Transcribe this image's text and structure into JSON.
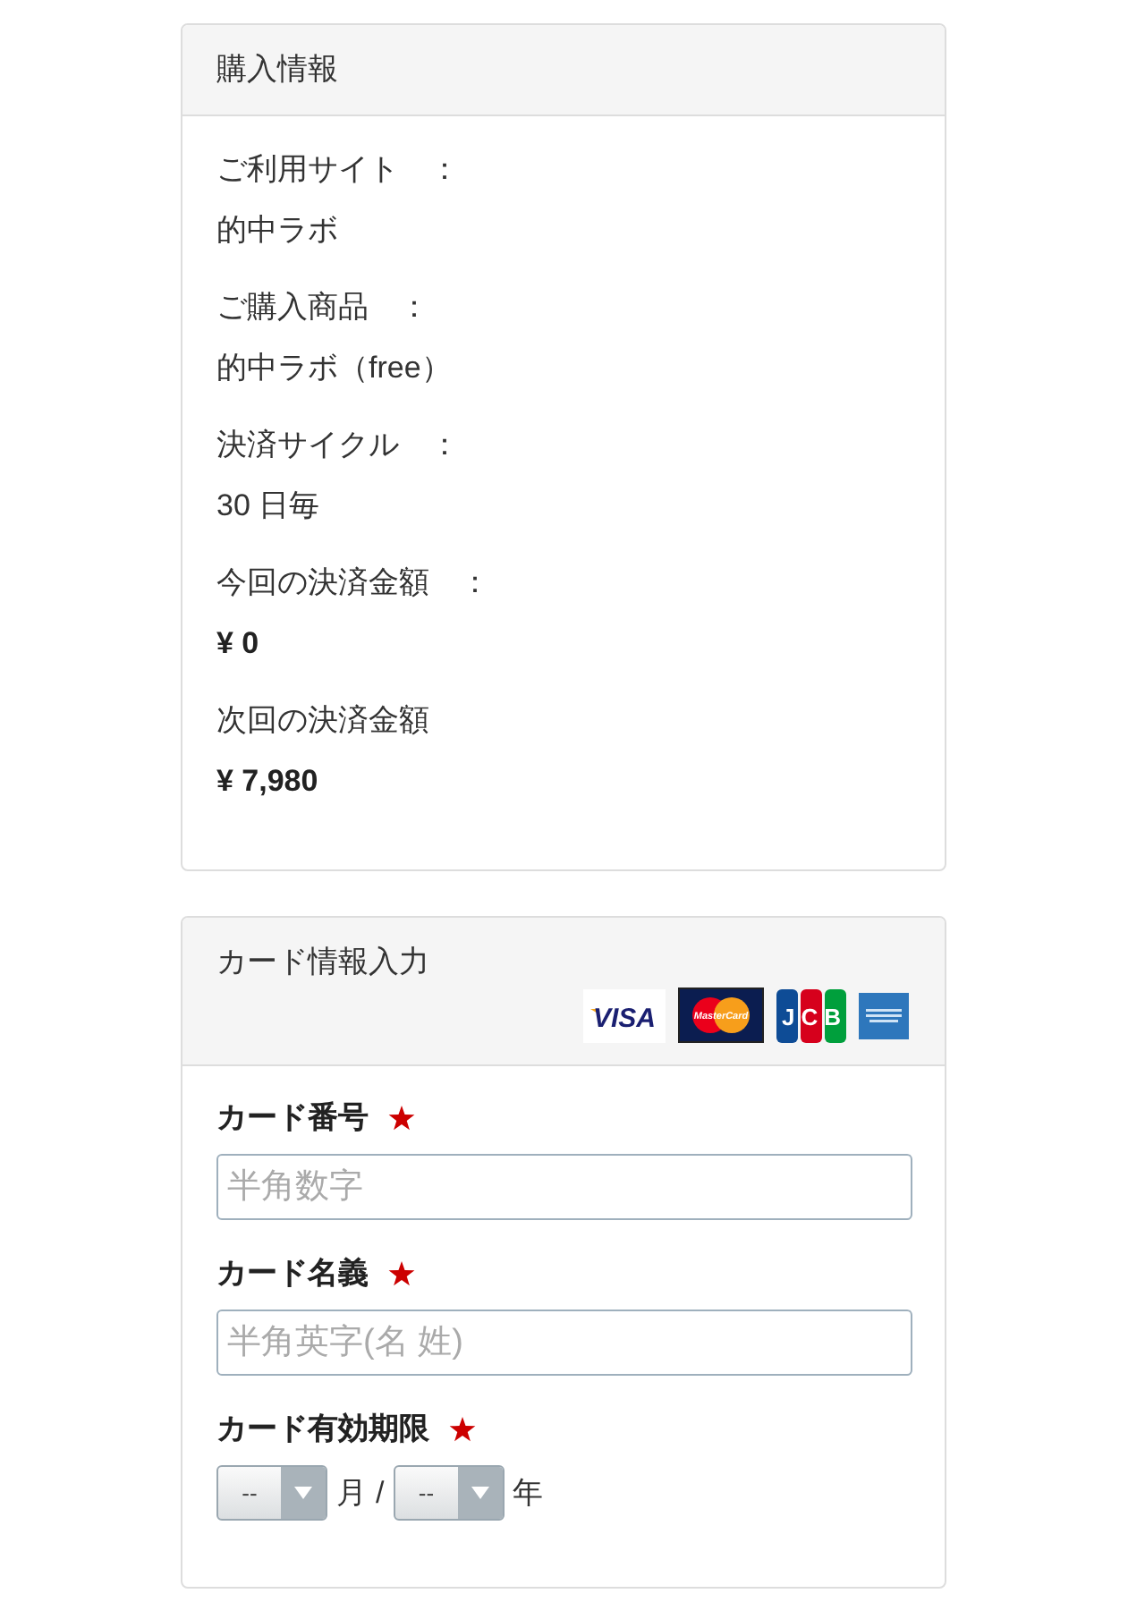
{
  "purchase_panel": {
    "title": "購入情報",
    "items": [
      {
        "kind": "text",
        "label": "ご利用サイト　：",
        "value": "的中ラボ"
      },
      {
        "kind": "text",
        "label": "ご購入商品　：",
        "value": "的中ラボ（free）"
      },
      {
        "kind": "text",
        "label": "決済サイクル　：",
        "value": "30 日毎"
      },
      {
        "kind": "amount",
        "label": "今回の決済金額　：",
        "value": "¥ 0"
      },
      {
        "kind": "amount",
        "label": "次回の決済金額",
        "value": "¥ 7,980"
      }
    ]
  },
  "card_panel": {
    "title": "カード情報入力",
    "card_brands": [
      {
        "kind": "visa",
        "label": "VISA"
      },
      {
        "kind": "mastercard",
        "label": "MasterCard"
      },
      {
        "kind": "jcb",
        "label": "JCB"
      },
      {
        "kind": "amex"
      }
    ],
    "fields": [
      {
        "kind": "text_input",
        "label": "カード番号",
        "required": true,
        "placeholder": "半角数字"
      },
      {
        "kind": "text_input",
        "label": "カード名義",
        "required": true,
        "placeholder": "半角英字(名 姓)"
      },
      {
        "kind": "expiry",
        "label": "カード有効期限",
        "required": true,
        "month": {
          "value": "--",
          "unit": "月"
        },
        "separator": "/",
        "year": {
          "value": "--",
          "unit": "年"
        }
      }
    ]
  }
}
